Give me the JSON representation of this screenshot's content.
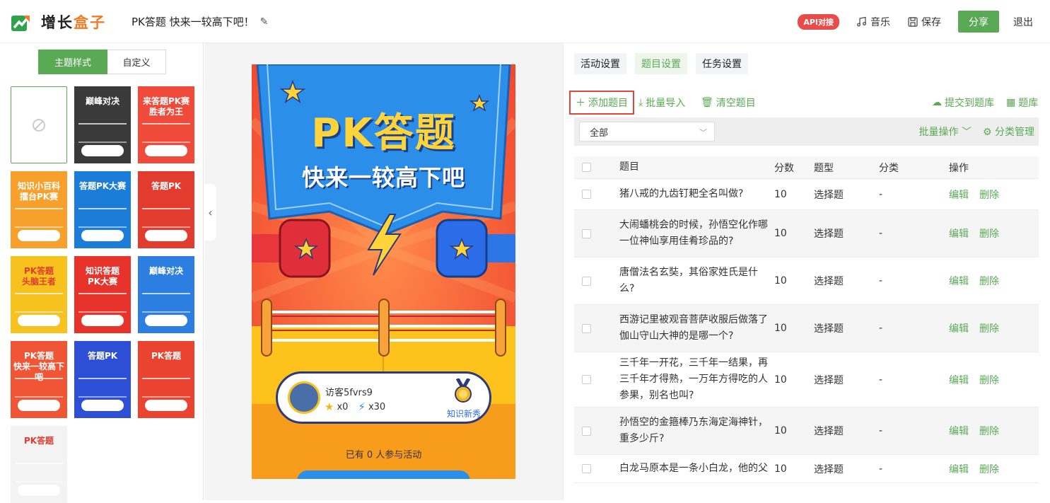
{
  "header": {
    "logo_text_a": "增长",
    "logo_text_b": "盒子",
    "page_title": "PK答题 快来一较高下吧！",
    "api_badge": "API对接",
    "music_label": "音乐",
    "save_label": "保存",
    "share_label": "分享",
    "logout_label": "退出"
  },
  "left": {
    "seg_theme": "主题样式",
    "seg_custom": "自定义",
    "themes": [
      {
        "title": "",
        "bg": "#ffffff"
      },
      {
        "title": "巅峰对决",
        "bg": "#3a3a3a"
      },
      {
        "title": "来答题PK赛\n胜者为王",
        "bg": "#f04a3a"
      },
      {
        "title": "知识小百科\n擂台PK赛",
        "bg": "#f7a12c"
      },
      {
        "title": "答题PK大赛",
        "bg": "#1c7dd9"
      },
      {
        "title": "答题PK",
        "bg": "#e23c2f"
      },
      {
        "title": "PK答题\n头脑王者",
        "bg": "#f7c21d"
      },
      {
        "title": "知识答题\nPK大赛",
        "bg": "#e8332d"
      },
      {
        "title": "巅峰对决",
        "bg": "#2c7ee0"
      },
      {
        "title": "PK答题\n快来一较高下吧",
        "bg": "#f05636"
      },
      {
        "title": "答题PK",
        "bg": "#2c4fd6"
      },
      {
        "title": "PK答题",
        "bg": "#ea4431"
      },
      {
        "title": "PK答题",
        "bg": "#f3f3f3"
      }
    ]
  },
  "preview": {
    "title": "PK答题",
    "subtitle": "快来一较高下吧",
    "user_name": "访客5fvrs9",
    "stars": "x0",
    "bolts": "x30",
    "medal_label": "知识新秀",
    "participants": "已有 0 人参与活动"
  },
  "right": {
    "tabs": [
      "活动设置",
      "题目设置",
      "任务设置"
    ],
    "add_question": "添加题目",
    "batch_import": "批量导入",
    "clear_questions": "清空题目",
    "submit_bank": "提交到题库",
    "bank": "题库",
    "filter_value": "全部",
    "batch_ops": "批量操作",
    "category_manage": "分类管理",
    "columns": [
      "题目",
      "分数",
      "题型",
      "分类",
      "操作"
    ],
    "edit_label": "编辑",
    "delete_label": "删除",
    "rows": [
      {
        "q": "猪八戒的九齿钉耙全名叫做?",
        "score": "10",
        "type": "选择题",
        "cat": "-"
      },
      {
        "q": "大闹蟠桃会的时候，孙悟空化作哪一位神仙享用佳肴珍品的?",
        "score": "10",
        "type": "选择题",
        "cat": "-"
      },
      {
        "q": "唐僧法名玄奘，其俗家姓氏是什么?",
        "score": "10",
        "type": "选择题",
        "cat": "-"
      },
      {
        "q": "西游记里被观音菩萨收服后做落了伽山守山大神的是哪一个?",
        "score": "10",
        "type": "选择题",
        "cat": "-"
      },
      {
        "q": "三千年一开花，三千年一结果，再三千年才得熟，一万年方得吃的人参果，别名也叫?",
        "score": "10",
        "type": "选择题",
        "cat": "-"
      },
      {
        "q": "孙悟空的金箍棒乃东海定海神针，重多少斤?",
        "score": "10",
        "type": "选择题",
        "cat": "-"
      },
      {
        "q": "白龙马原本是一条小白龙，他的父",
        "score": "10",
        "type": "选择题",
        "cat": "-"
      }
    ]
  }
}
